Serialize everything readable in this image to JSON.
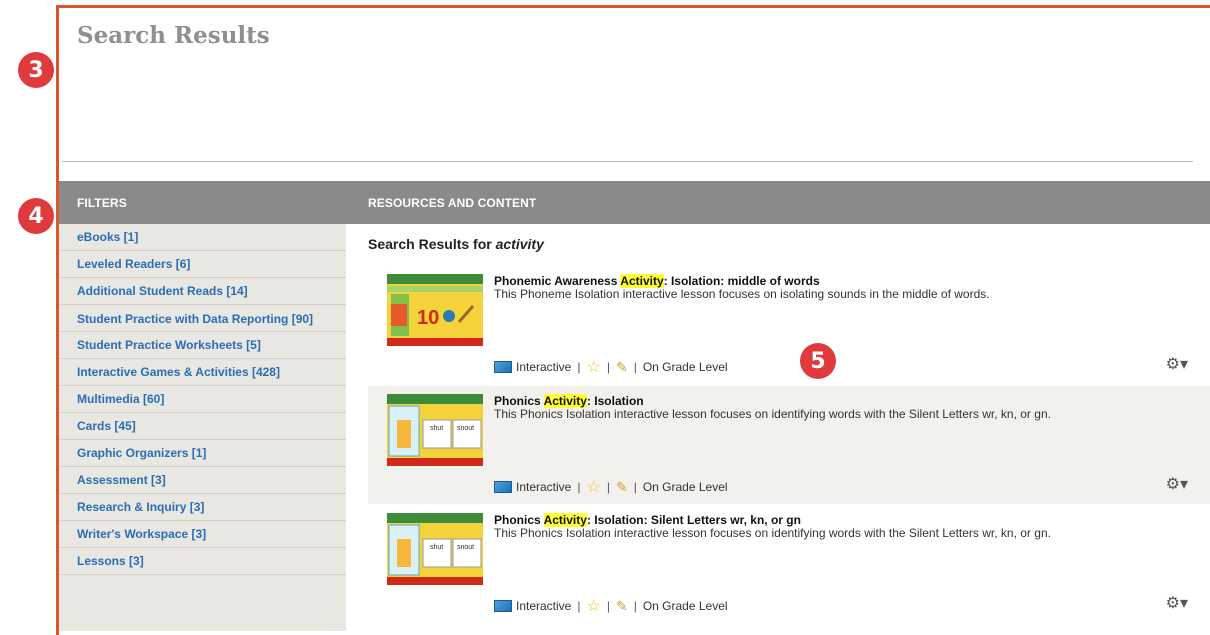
{
  "header": {
    "title": "Search Results"
  },
  "callouts": [
    "3",
    "4",
    "5"
  ],
  "filters": {
    "title": "FILTERS",
    "items": [
      "eBooks [1]",
      "Leveled Readers [6]",
      "Additional Student Reads [14]",
      "Student Practice with Data Reporting [90]",
      "Student Practice Worksheets [5]",
      "Interactive Games & Activities [428]",
      "Multimedia [60]",
      "Cards [45]",
      "Graphic Organizers [1]",
      "Assessment [3]",
      "Research & Inquiry [3]",
      "Writer's Workspace [3]",
      "Lessons [3]"
    ]
  },
  "results": {
    "title": "RESOURCES AND CONTENT",
    "search_label": "Search Results for",
    "search_term": "activity",
    "items": [
      {
        "title_prefix": "Phonemic Awareness ",
        "title_highlight": "Activity",
        "title_suffix": ": Isolation: middle of words",
        "description": "This Phoneme Isolation interactive lesson focuses on isolating sounds in the middle of words.",
        "type": "Interactive",
        "level": "On Grade Level",
        "thumb_number": "10"
      },
      {
        "title_prefix": "Phonics ",
        "title_highlight": "Activity",
        "title_suffix": ": Isolation",
        "description": "This Phonics Isolation interactive lesson focuses on identifying words with the Silent Letters wr, kn, or gn.",
        "type": "Interactive",
        "level": "On Grade Level",
        "thumb_words": [
          "shut",
          "snout"
        ]
      },
      {
        "title_prefix": "Phonics ",
        "title_highlight": "Activity",
        "title_suffix": ": Isolation: Silent Letters wr, kn, or gn",
        "description": "This Phonics Isolation interactive lesson focuses on identifying words with the Silent Letters wr, kn, or gn.",
        "type": "Interactive",
        "level": "On Grade Level",
        "thumb_words": [
          "shut",
          "snout"
        ]
      }
    ]
  },
  "colors": {
    "accent": "#d9572b",
    "callout": "#e03a3e",
    "link": "#2a6db5",
    "highlight": "#ffff33",
    "header_bg": "#8a8a8a"
  }
}
